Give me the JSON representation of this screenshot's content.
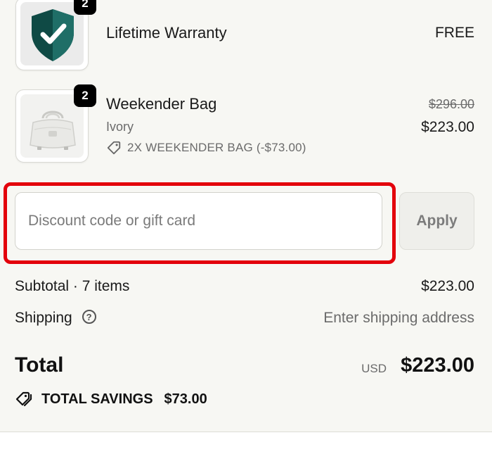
{
  "line_items": [
    {
      "name": "Lifetime Warranty",
      "quantity": "2",
      "price": "FREE",
      "icon": "shield-check-icon"
    },
    {
      "name": "Weekender Bag",
      "quantity": "2",
      "variant": "Ivory",
      "original_price": "$296.00",
      "price": "$223.00",
      "discount_text": "2X WEEKENDER BAG (-$73.00)",
      "icon": "bag-image"
    }
  ],
  "discount": {
    "placeholder": "Discount code or gift card",
    "apply_label": "Apply"
  },
  "subtotal": {
    "label": "Subtotal · 7 items",
    "value": "$223.00"
  },
  "shipping": {
    "label": "Shipping",
    "value": "Enter shipping address",
    "help_symbol": "?"
  },
  "total": {
    "label": "Total",
    "currency": "USD",
    "value": "$223.00"
  },
  "savings": {
    "label": "TOTAL SAVINGS",
    "value": "$73.00"
  },
  "colors": {
    "highlight": "#e3000b",
    "shield_dark": "#0f4a45",
    "shield_light": "#1f6e67",
    "background": "#f7f7f3"
  }
}
